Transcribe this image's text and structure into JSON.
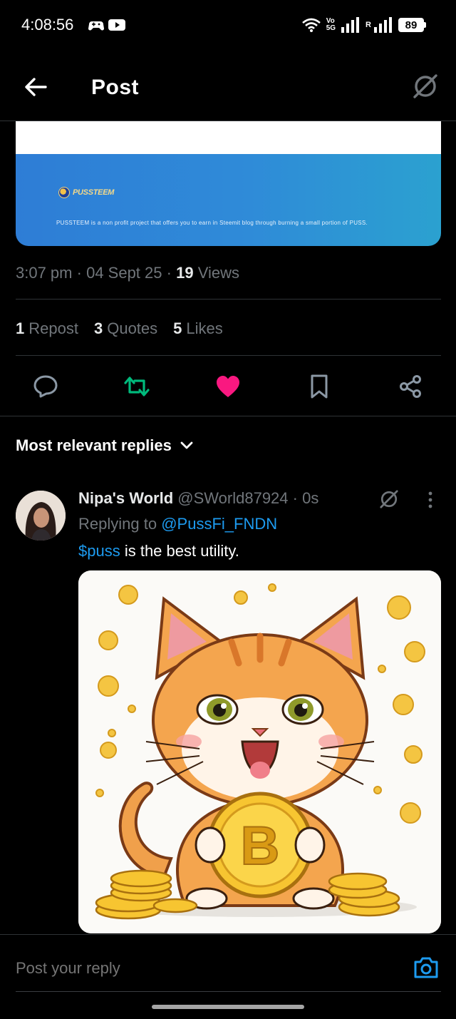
{
  "status_bar": {
    "time": "4:08:56",
    "volte_top": "Vo",
    "volte_bottom": "5G",
    "roaming": "R",
    "battery": "89"
  },
  "header": {
    "title": "Post",
    "back_icon": "arrow-left-icon",
    "grok_icon": "grok-icon"
  },
  "link_card": {
    "logo_text": "PUSSTEEM",
    "description": "PUSSTEEM is a non profit project that offers you to earn in Steemit blog through burning a small portion of PUSS."
  },
  "meta": {
    "time": "3:07 pm",
    "date": "04 Sept 25",
    "views_count": "19",
    "views_label": "Views"
  },
  "stats": {
    "reposts_count": "1",
    "reposts_label": "Repost",
    "quotes_count": "3",
    "quotes_label": "Quotes",
    "likes_count": "5",
    "likes_label": "Likes"
  },
  "actions": {
    "reply_icon": "reply-icon",
    "repost_icon": "repost-icon",
    "like_icon": "heart-icon",
    "bookmark_icon": "bookmark-icon",
    "share_icon": "share-icon",
    "repost_color": "#00ba7c",
    "like_color": "#f91880"
  },
  "replies": {
    "sort_label": "Most relevant replies",
    "items": [
      {
        "name": "Nipa's World",
        "handle": "@SWorld87924",
        "age": "0s",
        "replying_prefix": "Replying to",
        "replying_to": "@PussFi_FNDN",
        "text_tag": "$puss",
        "text_rest": " is the best utility."
      }
    ]
  },
  "compose": {
    "placeholder": "Post your reply"
  },
  "colors": {
    "background": "#000000",
    "link": "#1d9bf0",
    "muted": "#71767b",
    "divider": "#2f3336"
  }
}
